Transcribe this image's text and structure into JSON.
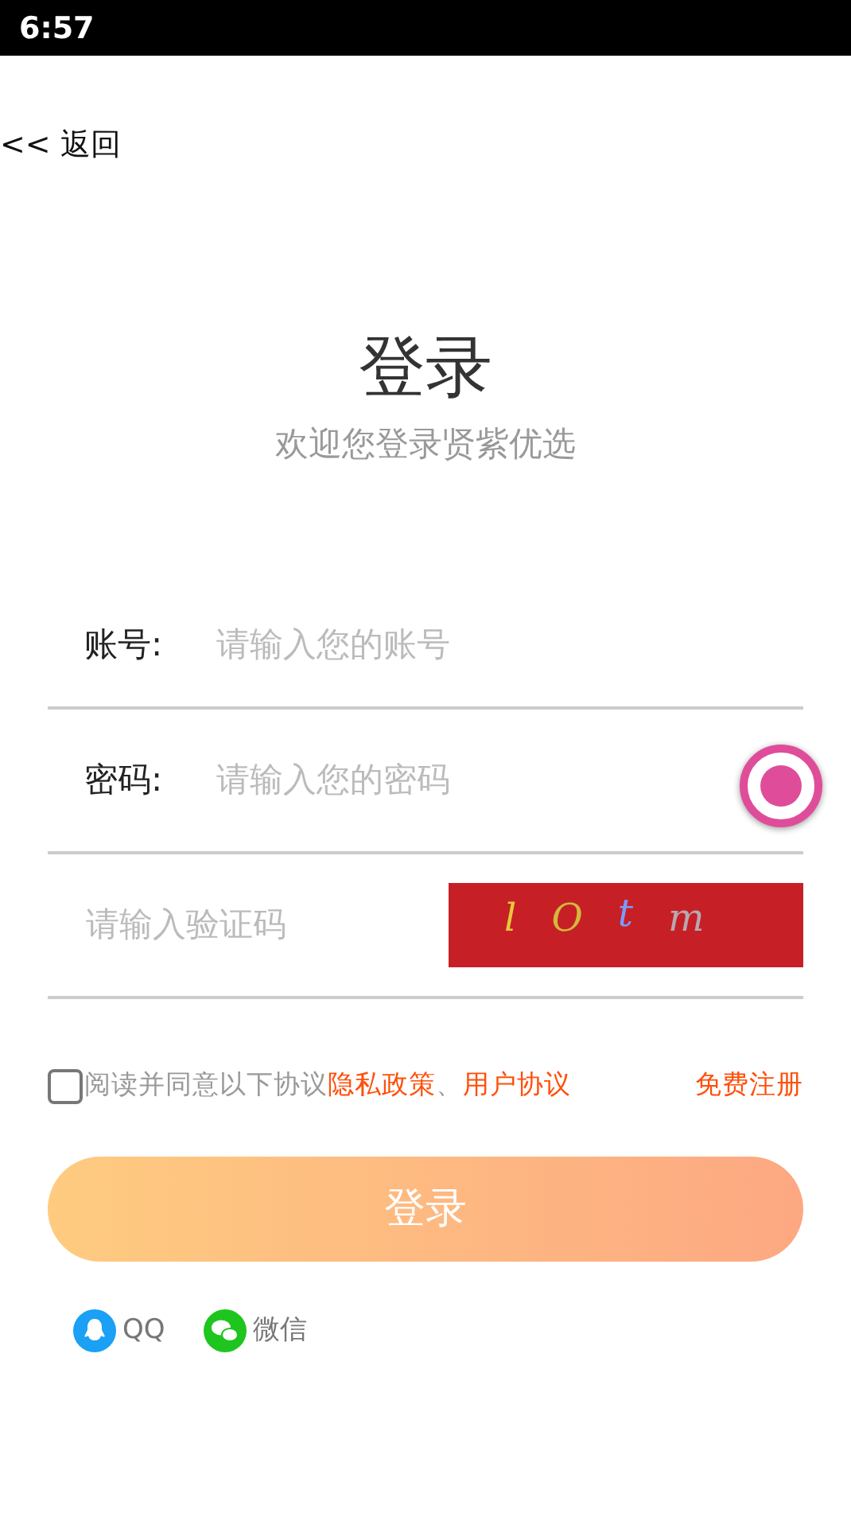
{
  "status_bar": {
    "time": "6:57"
  },
  "back_link": "<< 返回",
  "title": "登录",
  "subtitle": "欢迎您登录贤紫优选",
  "fields": [
    {
      "kind": "labeled",
      "label": "账号:",
      "placeholder": "请输入您的账号"
    },
    {
      "kind": "labeled",
      "label": "密码:",
      "placeholder": "请输入您的密码"
    },
    {
      "kind": "captcha",
      "placeholder": "请输入验证码",
      "captcha": [
        {
          "char": "l",
          "color": "#e8c83a"
        },
        {
          "char": "O",
          "color": "#d4b83c"
        },
        {
          "char": "t",
          "color": "#7a9cff"
        },
        {
          "char": "m",
          "color": "#b8a8b0"
        }
      ]
    }
  ],
  "agreement": {
    "checked": false,
    "text": "阅读并同意以下协议",
    "links": [
      "隐私政策",
      "用户协议"
    ],
    "separator": "、"
  },
  "register_link": "免费注册",
  "login_button": "登录",
  "social": [
    {
      "kind": "qq",
      "label": "QQ",
      "color": "#1aa0f5"
    },
    {
      "kind": "wechat",
      "label": "微信",
      "color": "#1ec51e"
    }
  ]
}
